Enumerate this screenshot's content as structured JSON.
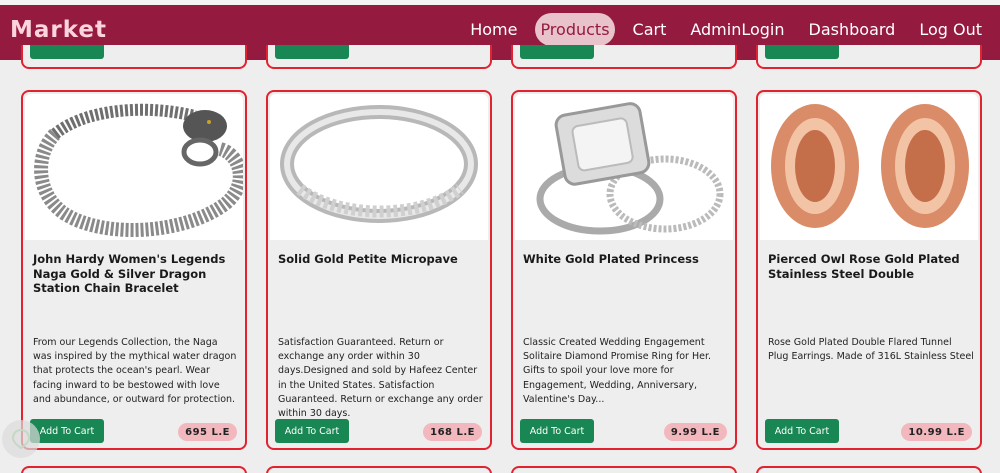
{
  "navbar": {
    "brand": "Market",
    "links": [
      {
        "label": "Home",
        "active": false
      },
      {
        "label": "Products",
        "active": true
      },
      {
        "label": "Cart",
        "active": false
      },
      {
        "label": "AdminLogin",
        "active": false
      },
      {
        "label": "Dashboard",
        "active": false
      },
      {
        "label": "Log Out",
        "active": false
      }
    ],
    "bg_color": "#951a40"
  },
  "products": [
    {
      "title": "John Hardy Women's Legends Naga Gold & Silver Dragon Station Chain Bracelet",
      "description": "From our Legends Collection, the Naga was inspired by the mythical water dragon that protects the ocean's pearl. Wear facing inward to be bestowed with love and abundance, or outward for protection.",
      "button": "Add To Cart",
      "price": "695 L.E",
      "image": "dragon-bracelet-image"
    },
    {
      "title": "Solid Gold Petite Micropave",
      "description": "Satisfaction Guaranteed. Return or exchange any order within 30 days.Designed and sold by Hafeez Center in the United States. Satisfaction Guaranteed. Return or exchange any order within 30 days.",
      "button": "Add To Cart",
      "price": "168 L.E",
      "image": "ring-image"
    },
    {
      "title": "White Gold Plated Princess",
      "description": "Classic Created Wedding Engagement Solitaire Diamond Promise Ring for Her. Gifts to spoil your love more for Engagement, Wedding, Anniversary, Valentine's Day...",
      "button": "Add To Cart",
      "price": "9.99 L.E",
      "image": "princess-ring-image"
    },
    {
      "title": "Pierced Owl Rose Gold Plated Stainless Steel Double",
      "description": "Rose Gold Plated Double Flared Tunnel Plug Earrings. Made of 316L Stainless Steel",
      "button": "Add To Cart",
      "price": "10.99 L.E",
      "image": "tunnel-earrings-image"
    }
  ],
  "colors": {
    "accent": "#e0232f",
    "button": "#198754",
    "price_bg": "#f2b8bd"
  }
}
